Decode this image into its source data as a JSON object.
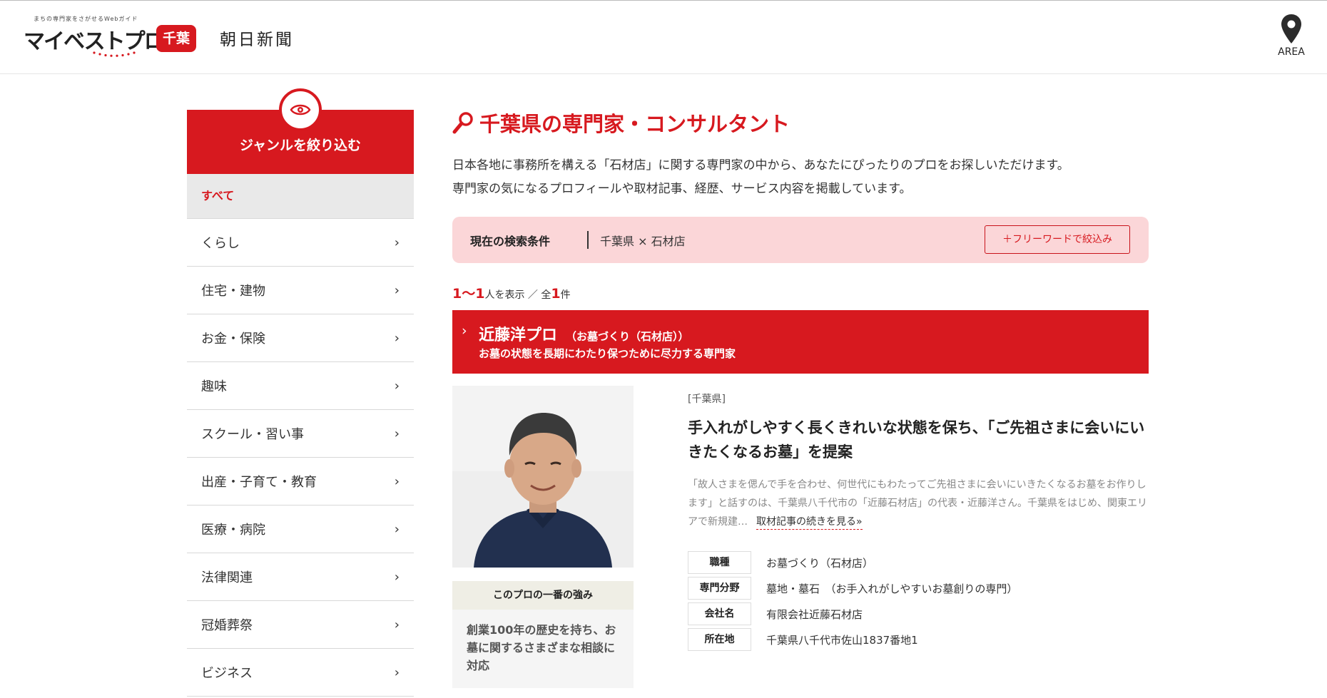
{
  "header": {
    "tagline": "まちの専門家をさがせるWebガイド",
    "logo_text": "マイベストプロ",
    "prefecture_badge": "千葉",
    "partner": "朝日新聞",
    "area_label": "AREA"
  },
  "sidebar": {
    "title": "ジャンルを絞り込む",
    "all_label": "すべて",
    "items": [
      {
        "label": "くらし"
      },
      {
        "label": "住宅・建物"
      },
      {
        "label": "お金・保険"
      },
      {
        "label": "趣味"
      },
      {
        "label": "スクール・習い事"
      },
      {
        "label": "出産・子育て・教育"
      },
      {
        "label": "医療・病院"
      },
      {
        "label": "法律関連"
      },
      {
        "label": "冠婚葬祭"
      },
      {
        "label": "ビジネス"
      }
    ]
  },
  "main": {
    "title": "千葉県の専門家・コンサルタント",
    "intro_line1": "日本各地に事務所を構える「石材店」に関する専門家の中から、あなたにぴったりのプロをお探しいただけます。",
    "intro_line2": "専門家の気になるプロフィールや取材記事、経歴、サービス内容を掲載しています。",
    "condition": {
      "label": "現在の検索条件",
      "value": "千葉県 × 石材店",
      "freeword_button": "＋フリーワードで絞込み"
    },
    "count": {
      "range": "1〜1",
      "range_suffix": "人を表示",
      "separator": " ／ 全",
      "total": "1",
      "total_suffix": "件"
    }
  },
  "pro": {
    "name": "近藤洋プロ",
    "genre": "（お墓づくり（石材店））",
    "subtitle": "お墓の状態を長期にわたり保つために尽力する専門家",
    "strength_title": "このプロの一番の強み",
    "strength_text": "創業100年の歴史を持ち、お墓に関するさまざまな相談に対応",
    "prefecture": "[千葉県]",
    "headline": "手入れがしやすく長くきれいな状態を保ち、「ご先祖さまに会いにいきたくなるお墓」を提案",
    "excerpt": "「故人さまを偲んで手を合わせ、何世代にもわたってご先祖さまに会いにいきたくなるお墓をお作りします」と話すのは、千葉県八千代市の「近藤石材店」の代表・近藤洋さん。千葉県をはじめ、関東エリアで新規建…",
    "read_more": "取材記事の続きを見る»",
    "info": [
      {
        "key": "職種",
        "value": "お墓づくり（石材店）"
      },
      {
        "key": "専門分野",
        "value": "墓地・墓石　（お手入れがしやすいお墓創りの専門）"
      },
      {
        "key": "会社名",
        "value": "有限会社近藤石材店"
      },
      {
        "key": "所在地",
        "value": "千葉県八千代市佐山1837番地1"
      }
    ]
  },
  "colors": {
    "brand_red": "#d7191f",
    "condition_bg": "#fbd6d8"
  }
}
